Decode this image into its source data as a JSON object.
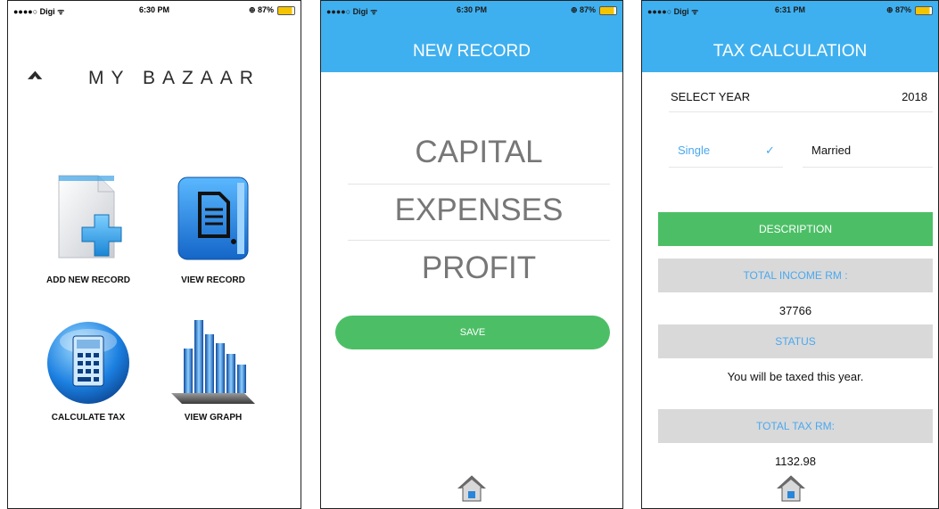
{
  "status_bars": [
    {
      "carrier": "●●●●○ Digi ᯤ",
      "time": "6:30 PM",
      "battery": "⊕ 87%"
    },
    {
      "carrier": "●●●●○ Digi ᯤ",
      "time": "6:30 PM",
      "battery": "⊕ 87%"
    },
    {
      "carrier": "●●●●○ Digi ᯤ",
      "time": "6:31 PM",
      "battery": "⊕ 87%"
    }
  ],
  "home_screen": {
    "logo": "MY BAZAAR",
    "tiles": [
      "ADD NEW RECORD",
      "VIEW RECORD",
      "CALCULATE TAX",
      "VIEW GRAPH"
    ]
  },
  "new_record": {
    "title": "NEW RECORD",
    "items": [
      "CAPITAL",
      "EXPENSES",
      "PROFIT"
    ],
    "save_label": "SAVE"
  },
  "tax_calc": {
    "title": "TAX CALCULATION",
    "select_year_label": "SELECT YEAR",
    "year_value": "2018",
    "options": [
      "Single",
      "Married"
    ],
    "checkmark": "✓",
    "description_label": "DESCRIPTION",
    "total_income_label": "TOTAL INCOME RM :",
    "total_income_value": "37766",
    "status_label": "STATUS",
    "status_value": "You will be taxed this year.",
    "total_tax_label": "TOTAL TAX RM:",
    "total_tax_value": "1132.98"
  },
  "colors": {
    "header": "#3fb0ef",
    "accent_green": "#4cbf66",
    "link_blue": "#4aa8ef",
    "gray_bar": "#d9d9d9"
  }
}
